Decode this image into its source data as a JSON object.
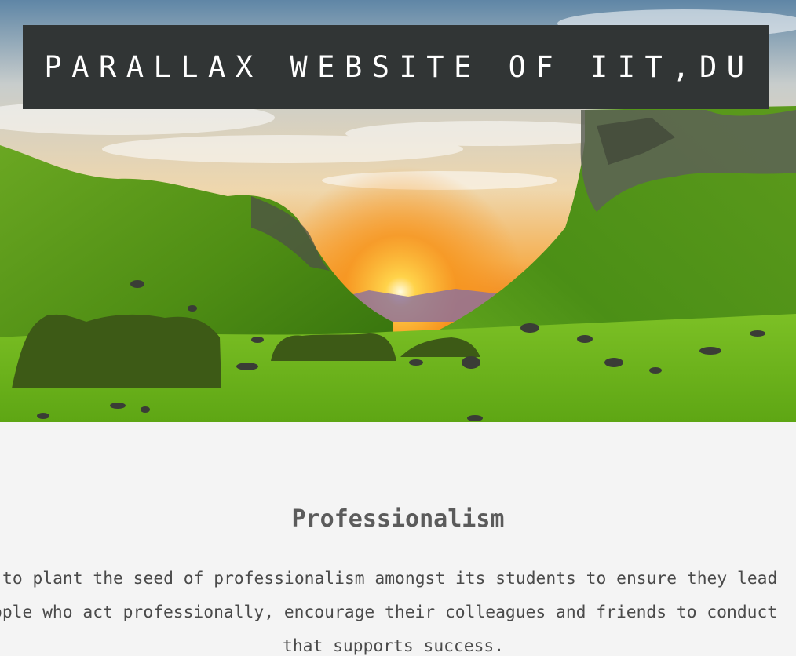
{
  "header": {
    "title": "PARALLAX WEBSITE OF IIT,DU"
  },
  "hero": {
    "image": "sunset-green-valley-landscape"
  },
  "section": {
    "heading": "Professionalism",
    "paragraph_lines": [
      "to plant the seed of professionalism amongst its students to ensure they lead",
      "ople who act professionally, encourage their colleagues and friends to conduct",
      "that supports success."
    ]
  },
  "colors": {
    "title_bg": "#313535",
    "title_text": "#ffffff",
    "section_bg": "#f4f4f4",
    "heading_text": "#5b5b5b",
    "body_text": "#4a4a4a"
  }
}
